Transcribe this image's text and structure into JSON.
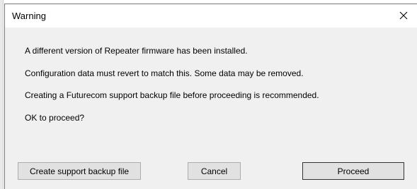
{
  "window": {
    "title": "Warning",
    "close_icon": "close-icon"
  },
  "message": {
    "line1": "A different version of Repeater firmware has been installed.",
    "line2": "Configuration data must revert to match this. Some data may be removed.",
    "line3": "Creating a Futurecom support backup file before proceeding is recommended.",
    "line4": "OK to proceed?"
  },
  "buttons": {
    "backup_label": "Create support backup file",
    "cancel_label": "Cancel",
    "proceed_label": "Proceed"
  },
  "colors": {
    "dialog_background": "#f0f0f0",
    "titlebar_background": "#ffffff",
    "button_face": "#e1e1e1",
    "button_border": "#adadad",
    "default_button_border": "#333333"
  }
}
